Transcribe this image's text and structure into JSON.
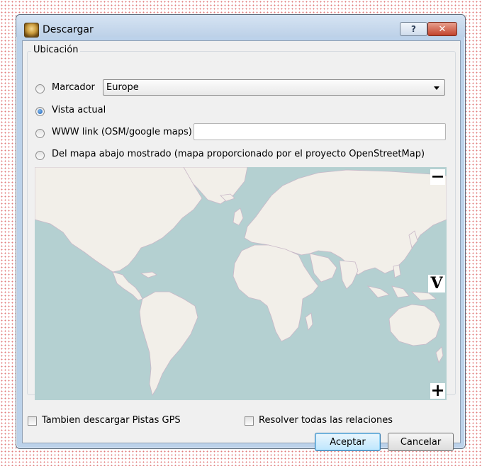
{
  "dialog": {
    "title": "Descargar",
    "icon": "josm-download-icon",
    "help_label": "?",
    "close_label": "✕"
  },
  "location": {
    "group_title": "Ubicación",
    "options": [
      {
        "label": "Marcador",
        "checked": false
      },
      {
        "label": "Vista actual",
        "checked": true
      },
      {
        "label": "WWW link (OSM/google maps)",
        "checked": false
      },
      {
        "label": "Del mapa abajo mostrado (mapa proporcionado por el proyecto OpenStreetMap)",
        "checked": false
      }
    ],
    "bookmark_value": "Europe",
    "www_link_value": ""
  },
  "map": {
    "zoom_out_label": "−",
    "zoom_in_label": "+",
    "layer_label": "V",
    "ocean_color": "#b4d0d1",
    "land_color": "#f2efe9"
  },
  "options": {
    "gps_label": "Tambien descargar Pistas GPS",
    "gps_checked": false,
    "relations_label": "Resolver todas las relaciones",
    "relations_checked": false
  },
  "buttons": {
    "accept": "Aceptar",
    "cancel": "Cancelar"
  }
}
